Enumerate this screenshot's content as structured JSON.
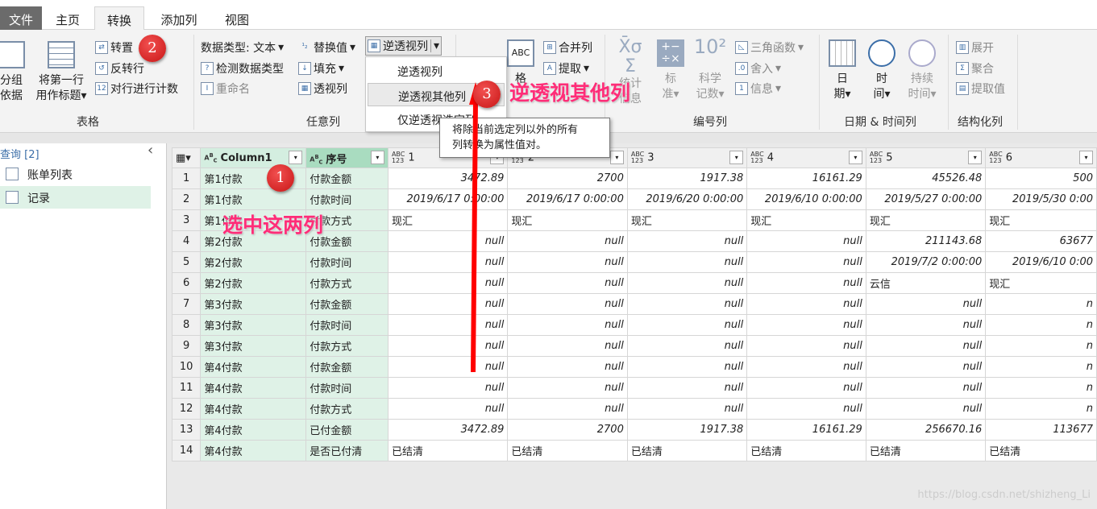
{
  "tabs": [
    "文件",
    "主页",
    "转换",
    "添加列",
    "视图"
  ],
  "ribbon": {
    "table_group": {
      "label": "表格",
      "group_by": [
        "分组",
        "依据"
      ],
      "use_first_row": [
        "将第一行",
        "用作标题"
      ],
      "transpose": "转置",
      "reverse_rows": "反转行",
      "count_rows": "对行进行计数"
    },
    "any_column": {
      "label": "任意列",
      "data_type": "数据类型: 文本",
      "detect_type": "检测数据类型",
      "rename": "重命名",
      "replace": "替换值",
      "fill": "填充",
      "pivot": "透视列",
      "unpivot": "逆透视列"
    },
    "text_column": {
      "merge": "合并列",
      "extract": "提取",
      "format": "格"
    },
    "number_column": {
      "label": "编号列",
      "stats": [
        "统计",
        "信息"
      ],
      "standard": [
        "标",
        "准"
      ],
      "scientific": [
        "科学",
        "记数"
      ],
      "trig": "三角函数",
      "round": "舍入",
      "info": "信息"
    },
    "datetime": {
      "label": "日期 & 时间列",
      "date": [
        "日",
        "期"
      ],
      "time": [
        "时",
        "间"
      ],
      "duration": [
        "持续",
        "时间"
      ]
    },
    "structured": {
      "label": "结构化列",
      "expand": "展开",
      "aggregate": "聚合",
      "extract_values": "提取值"
    }
  },
  "menu": [
    "逆透视列",
    "逆透视其他列",
    "仅逆透视选定列"
  ],
  "tooltip": [
    "将除当前选定列以外的所有",
    "列转换为属性值对。"
  ],
  "queries": {
    "title": "查询 [2]",
    "items": [
      "账单列表",
      "记录"
    ]
  },
  "grid": {
    "headers": [
      "Column1",
      "序号",
      "1",
      "2",
      "3",
      "4",
      "5",
      "6"
    ],
    "rows": [
      [
        "第1付款",
        "付款金额",
        "3472.89",
        "2700",
        "1917.38",
        "16161.29",
        "45526.48",
        "500"
      ],
      [
        "第1付款",
        "付款时间",
        "2019/6/17 0:00:00",
        "2019/6/17 0:00:00",
        "2019/6/20 0:00:00",
        "2019/6/10 0:00:00",
        "2019/5/27 0:00:00",
        "2019/5/30 0:00"
      ],
      [
        "第1付款",
        "付款方式",
        "现汇",
        "现汇",
        "现汇",
        "现汇",
        "现汇",
        "现汇"
      ],
      [
        "第2付款",
        "付款金额",
        "null",
        "null",
        "null",
        "null",
        "211143.68",
        "63677"
      ],
      [
        "第2付款",
        "付款时间",
        "null",
        "null",
        "null",
        "null",
        "2019/7/2 0:00:00",
        "2019/6/10 0:00"
      ],
      [
        "第2付款",
        "付款方式",
        "null",
        "null",
        "null",
        "null",
        "云信",
        "现汇"
      ],
      [
        "第3付款",
        "付款金额",
        "null",
        "null",
        "null",
        "null",
        "null",
        "n"
      ],
      [
        "第3付款",
        "付款时间",
        "null",
        "null",
        "null",
        "null",
        "null",
        "n"
      ],
      [
        "第3付款",
        "付款方式",
        "null",
        "null",
        "null",
        "null",
        "null",
        "n"
      ],
      [
        "第4付款",
        "付款金额",
        "null",
        "null",
        "null",
        "null",
        "null",
        "n"
      ],
      [
        "第4付款",
        "付款时间",
        "null",
        "null",
        "null",
        "null",
        "null",
        "n"
      ],
      [
        "第4付款",
        "付款方式",
        "null",
        "null",
        "null",
        "null",
        "null",
        "n"
      ],
      [
        "第4付款",
        "已付金额",
        "3472.89",
        "2700",
        "1917.38",
        "16161.29",
        "256670.16",
        "113677"
      ],
      [
        "第4付款",
        "是否已付清",
        "已结清",
        "已结清",
        "已结清",
        "已结清",
        "已结清",
        "已结清"
      ]
    ]
  },
  "annotations": {
    "step1": "1",
    "step2": "2",
    "step3": "3",
    "select_text": "选中这两列",
    "unpivot_text": "逆透视其他列"
  },
  "watermark": "https://blog.csdn.net/shizheng_Li",
  "colors": {
    "selected_col": "#d4eee0",
    "annotation_pink": "#ff2d78",
    "arrow": "#ff0000"
  }
}
